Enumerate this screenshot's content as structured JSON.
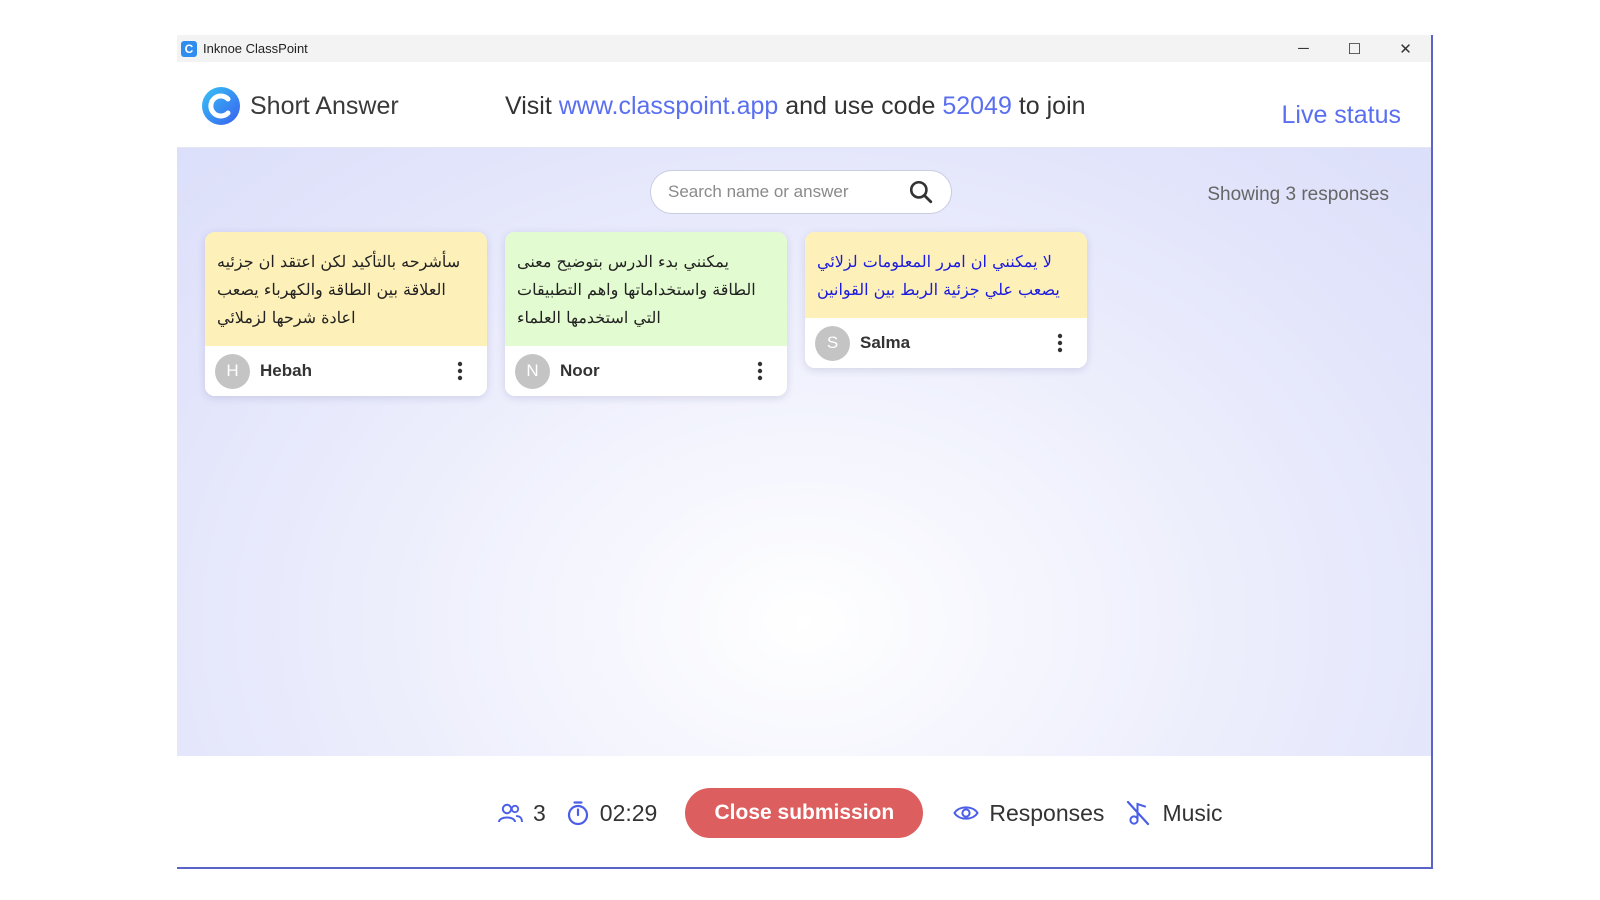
{
  "window": {
    "title": "Inknoe ClassPoint",
    "controls": {
      "minimize": "─",
      "maximize": "☐",
      "close": "✕"
    }
  },
  "header": {
    "mode_title": "Short Answer",
    "join": {
      "prefix": "Visit",
      "url": "www.classpoint.app",
      "middle": "and use code",
      "code": "52049",
      "suffix": "to join"
    },
    "live_status": "Live status"
  },
  "search": {
    "placeholder": "Search name or answer"
  },
  "showing_label": "Showing 3 responses",
  "responses": [
    {
      "text": "سأشرحه بالتأكيد لكن اعتقد ان جزئيه العلاقة بين الطاقة والكهرباء يصعب اعادة شرحها لزملائي",
      "name": "Hebah",
      "initial": "H",
      "bg": "#fdf0b8",
      "color": "#222222"
    },
    {
      "text": "يمكنني بدء الدرس بتوضيح معنى الطاقة واستخداماتها واهم التطبيقات التي استخدمها العلماء",
      "name": "Noor",
      "initial": "N",
      "bg": "#e2fbd0",
      "color": "#222222"
    },
    {
      "text": "لا يمكنني ان امرر المعلومات لزلائي يصعب علي جزئية الربط بين القوانين",
      "name": "Salma",
      "initial": "S",
      "bg": "#fdf0b8",
      "color": "#1a1ae0"
    }
  ],
  "footer": {
    "participants": "3",
    "timer": "02:29",
    "close_label": "Close submission",
    "responses_label": "Responses",
    "music_label": "Music"
  },
  "colors": {
    "accent": "#5a6ff0",
    "close_button": "#dd5e5e"
  }
}
